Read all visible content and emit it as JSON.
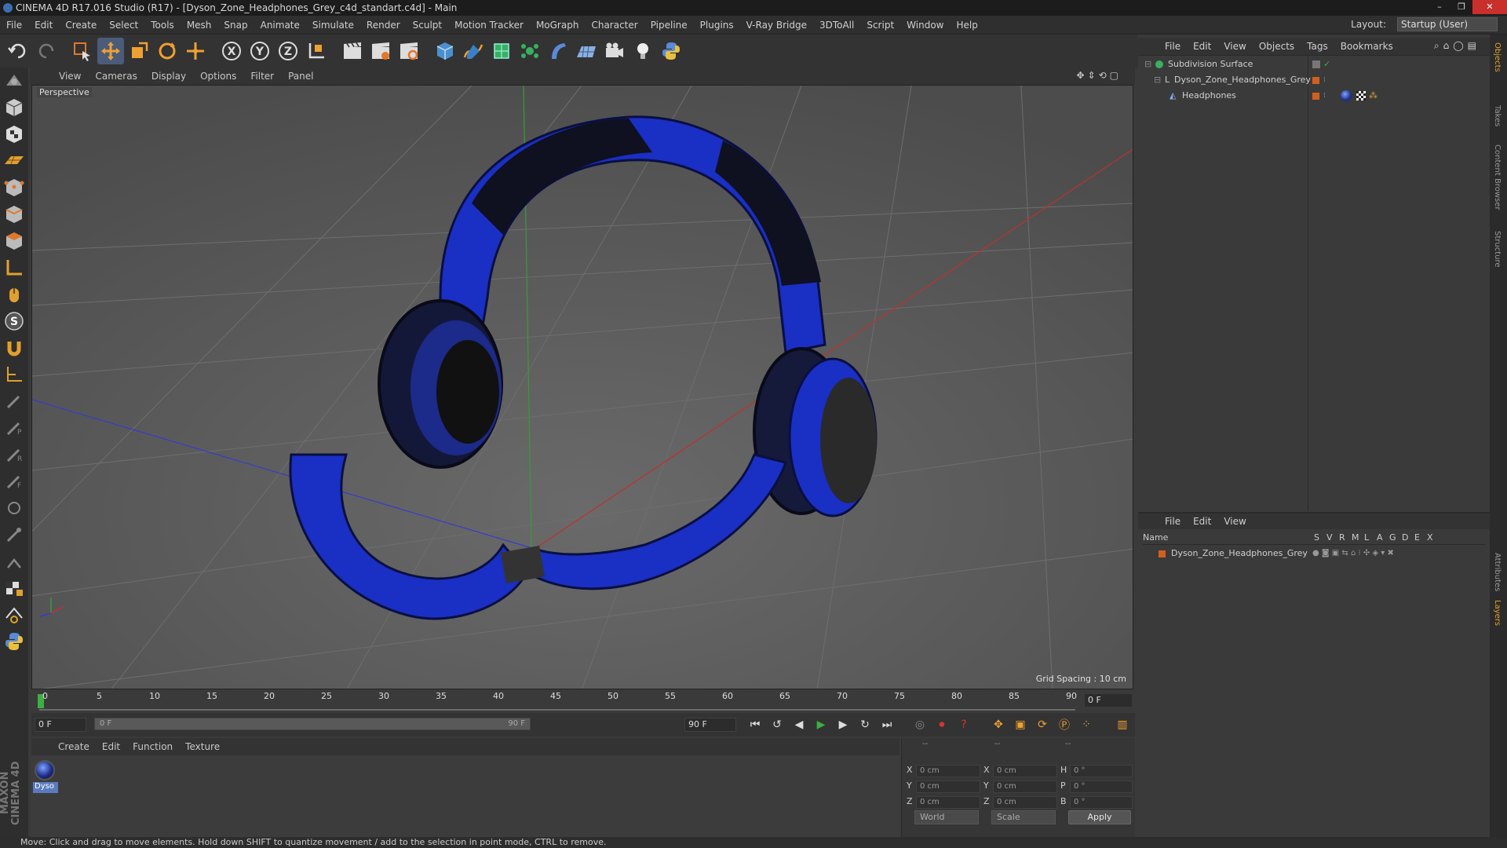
{
  "window": {
    "title": "CINEMA 4D R17.016 Studio (R17) - [Dyson_Zone_Headphones_Grey_c4d_standart.c4d] - Main",
    "minimize": "–",
    "maximize": "❐",
    "close": "✕"
  },
  "menubar": [
    "File",
    "Edit",
    "Create",
    "Select",
    "Tools",
    "Mesh",
    "Snap",
    "Animate",
    "Simulate",
    "Render",
    "Sculpt",
    "Motion Tracker",
    "MoGraph",
    "Character",
    "Pipeline",
    "Plugins",
    "V-Ray Bridge",
    "3DToAll",
    "Script",
    "Window",
    "Help"
  ],
  "layout": {
    "label": "Layout:",
    "value": "Startup (User)"
  },
  "viewport": {
    "menu": [
      "View",
      "Cameras",
      "Display",
      "Options",
      "Filter",
      "Panel"
    ],
    "label": "Perspective",
    "grid_spacing": "Grid Spacing : 10 cm",
    "model_color": "#1a2fc4"
  },
  "timeline": {
    "ticks": [
      "0",
      "5",
      "10",
      "15",
      "20",
      "25",
      "30",
      "35",
      "40",
      "45",
      "50",
      "55",
      "60",
      "65",
      "70",
      "75",
      "80",
      "85",
      "90"
    ],
    "current_frame": "0 F"
  },
  "transport": {
    "start": "0 F",
    "range_start": "0 F",
    "range_end": "90 F",
    "end": "90 F"
  },
  "materials": {
    "menu": [
      "Create",
      "Edit",
      "Function",
      "Texture"
    ],
    "items": [
      {
        "name": "Dyso"
      }
    ]
  },
  "coordinates": {
    "headers": [
      "--",
      "--",
      "--"
    ],
    "rows": [
      {
        "axis": "X",
        "pos": "0 cm",
        "size_axis": "X",
        "size": "0 cm",
        "rot_axis": "H",
        "rot": "0 °"
      },
      {
        "axis": "Y",
        "pos": "0 cm",
        "size_axis": "Y",
        "size": "0 cm",
        "rot_axis": "P",
        "rot": "0 °"
      },
      {
        "axis": "Z",
        "pos": "0 cm",
        "size_axis": "Z",
        "size": "0 cm",
        "rot_axis": "B",
        "rot": "0 °"
      }
    ],
    "mode": "World",
    "transform": "Scale",
    "apply": "Apply"
  },
  "object_manager": {
    "menu": [
      "File",
      "Edit",
      "View",
      "Objects",
      "Tags",
      "Bookmarks"
    ],
    "objects": [
      {
        "name": "Subdivision Surface",
        "indent": 0
      },
      {
        "name": "Dyson_Zone_Headphones_Grey",
        "indent": 1
      },
      {
        "name": "Headphones",
        "indent": 2
      }
    ]
  },
  "layer_manager": {
    "menu": [
      "File",
      "Edit",
      "View"
    ],
    "columns": [
      "Name",
      "S",
      "V",
      "R",
      "M",
      "L",
      "A",
      "G",
      "D",
      "E",
      "X"
    ],
    "layers": [
      {
        "name": "Dyson_Zone_Headphones_Grey",
        "color": "#d06020"
      }
    ]
  },
  "side_tabs": [
    "Objects",
    "Takes",
    "Content Browser",
    "Structure",
    "Attributes",
    "Layers"
  ],
  "status": "Move: Click and drag to move elements. Hold down SHIFT to quantize movement / add to the selection in point mode, CTRL to remove."
}
